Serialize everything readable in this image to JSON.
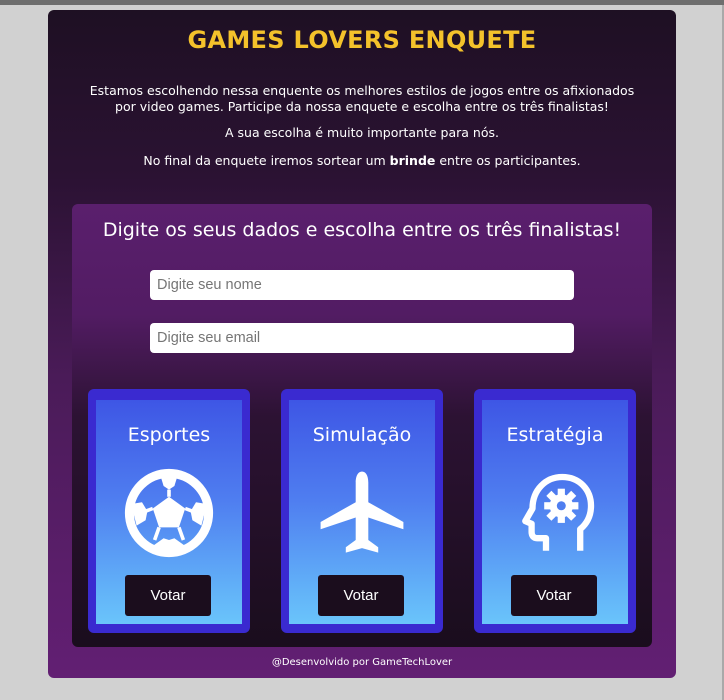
{
  "page": {
    "title": "GAMES LOVERS ENQUETE",
    "intro_paragraph": "Estamos escolhendo nessa enquente os melhores estilos de jogos entre os afixionados por video games. Participe da nossa enquete e escolha entre os três finalistas!",
    "importance_text": "A sua escolha é muito importante para nós.",
    "prize_text_before": "No final da enquete iremos sortear um ",
    "prize_text_bold": "brinde",
    "prize_text_after": " entre os participantes."
  },
  "form": {
    "heading": "Digite os seus dados e escolha entre os três finalistas!",
    "name_field": {
      "placeholder": "Digite seu nome",
      "value": ""
    },
    "email_field": {
      "placeholder": "Digite seu email",
      "value": ""
    }
  },
  "options": [
    {
      "title": "Esportes",
      "icon": "soccer-ball-icon",
      "button_label": "Votar"
    },
    {
      "title": "Simulação",
      "icon": "airplane-icon",
      "button_label": "Votar"
    },
    {
      "title": "Estratégia",
      "icon": "head-gear-icon",
      "button_label": "Votar"
    }
  ],
  "footer": {
    "text": "@Desenvolvido por GameTechLover"
  },
  "colors": {
    "title": "#f4c22b",
    "page_background": "#d1d1d1",
    "card_border": "#3a2ad0",
    "card_gradient_top": "#3e56e5",
    "card_gradient_bottom": "#6ac4fb",
    "vote_button": "#1b0d1d"
  }
}
